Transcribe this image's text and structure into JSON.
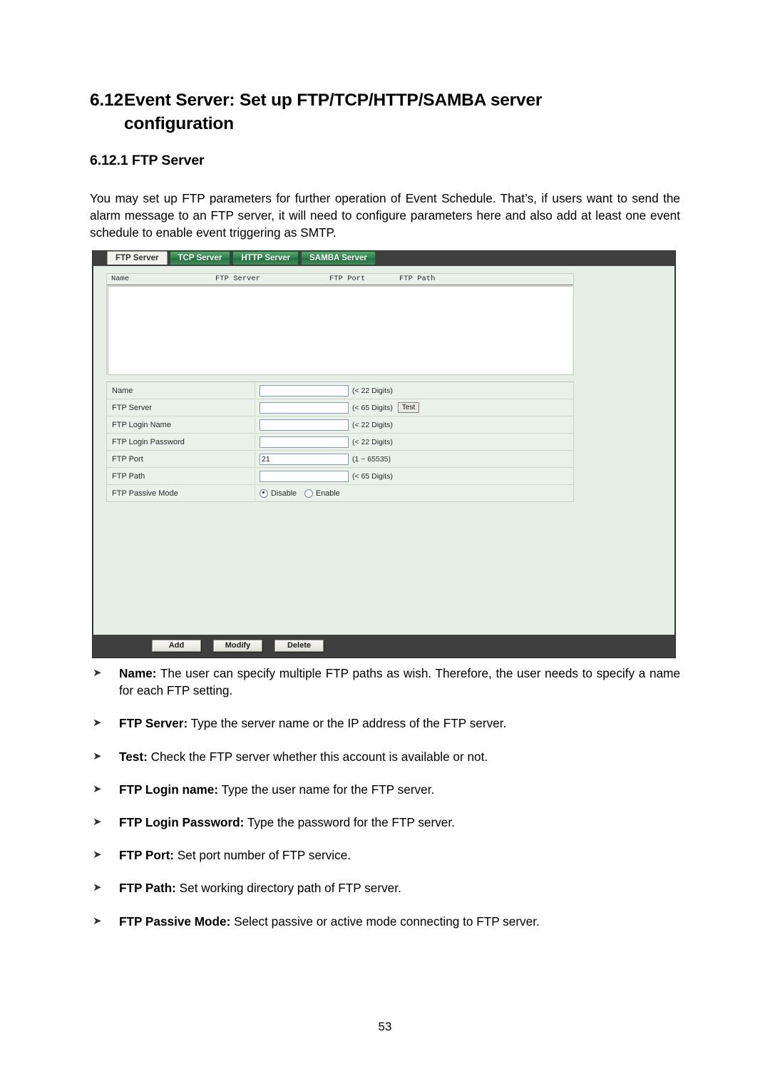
{
  "document": {
    "section_number": "6.12",
    "section_title": "Event Server: Set up FTP/TCP/HTTP/SAMBA server configuration",
    "subsection_heading": "6.12.1 FTP Server",
    "intro_paragraph": "You may set up FTP parameters for further operation of Event Schedule. That’s, if users want to send the alarm message to an FTP server, it will need to configure parameters here and also add at least one event schedule to enable event triggering as SMTP.",
    "page_number": "53"
  },
  "screenshot": {
    "tabs": [
      {
        "label": "FTP Server",
        "active": true
      },
      {
        "label": "TCP Server",
        "active": false
      },
      {
        "label": "HTTP Server",
        "active": false
      },
      {
        "label": "SAMBA Server",
        "active": false
      }
    ],
    "list": {
      "columns": [
        "Name",
        "FTP Server",
        "FTP Port",
        "FTP Path"
      ],
      "rows": []
    },
    "form": {
      "rows": [
        {
          "label": "Name",
          "value": "",
          "hint": "(< 22 Digits)",
          "type": "text"
        },
        {
          "label": "FTP Server",
          "value": "",
          "hint": "(< 65 Digits)",
          "type": "text",
          "button": "Test"
        },
        {
          "label": "FTP Login Name",
          "value": "",
          "hint": "(< 22 Digits)",
          "type": "text"
        },
        {
          "label": "FTP Login Password",
          "value": "",
          "hint": "(< 22 Digits)",
          "type": "text"
        },
        {
          "label": "FTP Port",
          "value": "21",
          "hint": "(1 ~ 65535)",
          "type": "text"
        },
        {
          "label": "FTP Path",
          "value": "",
          "hint": "(< 65 Digits)",
          "type": "text"
        },
        {
          "label": "FTP Passive Mode",
          "type": "radio",
          "options": [
            "Disable",
            "Enable"
          ],
          "selected": "Disable"
        }
      ]
    },
    "actions": [
      {
        "label": "Add"
      },
      {
        "label": "Modify"
      },
      {
        "label": "Delete"
      }
    ],
    "colors": {
      "tab_active_bg": "#f2f2ee",
      "tab_inactive_bg": "#2f8049",
      "panel_chrome": "#3f3f3f",
      "panel_body": "#e6efe6"
    }
  },
  "bullets": [
    {
      "term": "Name:",
      "text": " The user can specify multiple FTP paths as wish. Therefore, the user needs to specify a name for each FTP setting."
    },
    {
      "term": "FTP Server:",
      "text": " Type the server name or the IP address of the FTP server."
    },
    {
      "term": "Test:",
      "text": " Check the FTP server whether this account is available or not."
    },
    {
      "term": "FTP Login name:",
      "text": " Type the user name for the FTP server."
    },
    {
      "term": "FTP Login Password:",
      "text": " Type the password for the FTP server."
    },
    {
      "term": "FTP Port:",
      "text": " Set port number of FTP service."
    },
    {
      "term": "FTP Path:",
      "text": " Set working directory path of FTP server."
    },
    {
      "term": "FTP Passive Mode:",
      "text": " Select passive or active mode connecting to FTP server."
    }
  ]
}
